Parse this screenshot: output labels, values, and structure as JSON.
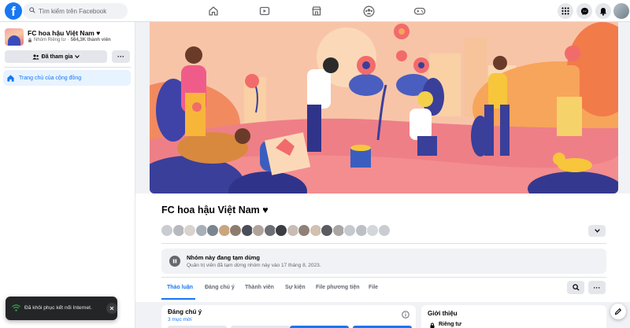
{
  "topbar": {
    "logo": "f",
    "search_placeholder": "Tìm kiếm trên Facebook",
    "nav_icons": [
      "home-icon",
      "video-icon",
      "marketplace-icon",
      "groups-icon",
      "gaming-icon"
    ],
    "right_icons": [
      "menu-grid-icon",
      "messenger-icon",
      "notifications-icon",
      "account-avatar"
    ]
  },
  "sidebar": {
    "group_name": "FC hoa hậu Việt Nam ♥",
    "privacy": "Nhóm Riêng tư",
    "separator": "·",
    "member_count": "564,3K thành viên",
    "joined_label": "Đã tham gia",
    "more_label": "···",
    "home_label": "Trang chủ của cộng đồng"
  },
  "group": {
    "title": "FC hoa hậu Việt Nam ♥",
    "member_avatar_colors": [
      "#c9ccd1",
      "#b8b9be",
      "#d8d3cf",
      "#a7b0b8",
      "#7a8590",
      "#caa57d",
      "#8d7c6e",
      "#4a4e58",
      "#b0a49a",
      "#6d6f75",
      "#3b3d42",
      "#c7bdb4",
      "#8f8178",
      "#d2c1b1",
      "#595b61",
      "#a9a6a5",
      "#c6c9ce",
      "#bcc0c6",
      "#d3d6da",
      "#c9cdd2"
    ],
    "paused_title": "Nhóm này đang tạm dừng",
    "paused_subtitle": "Quản trị viên đã tạm dừng nhóm này vào 17 tháng 8, 2023.",
    "tabs": [
      "Thảo luận",
      "Đáng chú ý",
      "Thành viên",
      "Sự kiện",
      "File phương tiện",
      "File"
    ],
    "search_icon": "search-icon",
    "more_label": "···"
  },
  "featured": {
    "title": "Đáng chú ý",
    "new_count": "3 mục mới"
  },
  "about": {
    "title": "Giới thiệu",
    "privacy": "Riêng tư"
  },
  "toast": {
    "text": "Đã khôi phục kết nối Internet."
  },
  "colors": {
    "brand": "#1877f2",
    "cover_bg": "#f7b79a",
    "cover_accent": "#f26b6b"
  }
}
